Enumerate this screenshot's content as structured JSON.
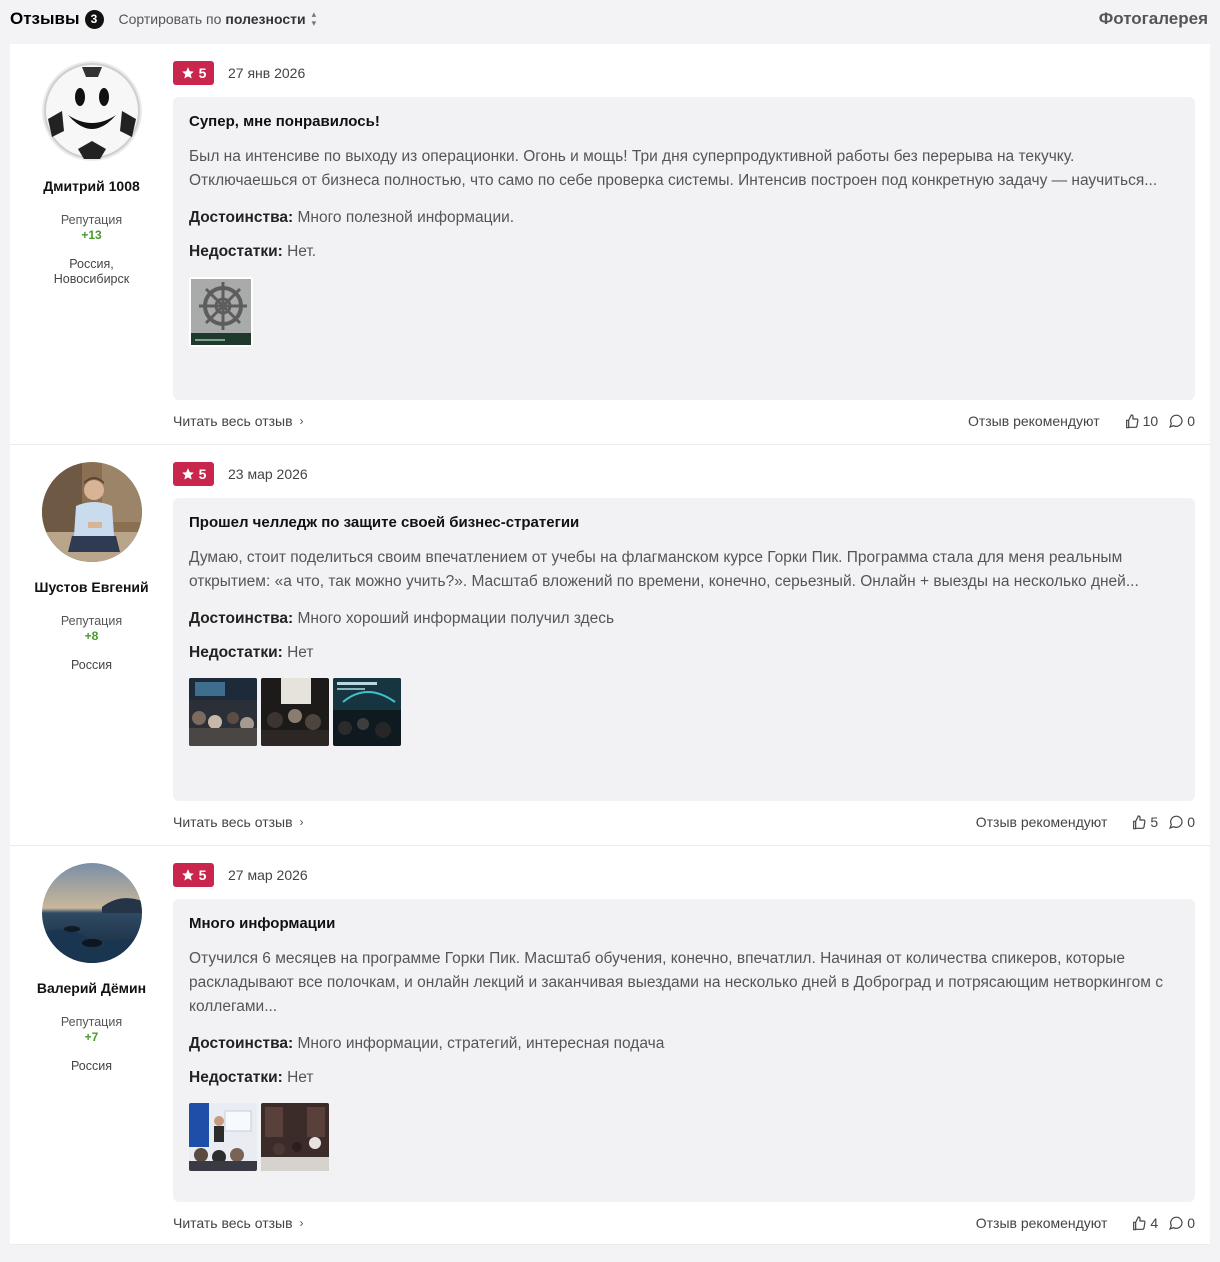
{
  "header": {
    "title": "Отзывы",
    "count": "3",
    "sort_prefix": "Сортировать по",
    "sort_value": "полезности",
    "gallery": "Фотогалерея"
  },
  "labels": {
    "reputation": "Репутация",
    "pros": "Достоинства:",
    "cons": "Недостатки:",
    "read_more": "Читать весь отзыв",
    "recommend": "Отзыв рекомендуют"
  },
  "colors": {
    "rating_badge": "#c8264d",
    "reputation": "#4a9a2a"
  },
  "reviews": [
    {
      "author": "Дмитрий 1008",
      "reputation": "+13",
      "location": "Россия, Новосибирск",
      "rating": "5",
      "date": "27 янв 2026",
      "headline": "Супер, мне понравилось!",
      "text": "Был на интенсиве по выходу из операционки. Огонь и мощь! Три дня суперпродуктивной работы без перерыва на текучку. Отключаешься от бизнеса полностью, что само по себе проверка системы. Интенсив построен под конкретную задачу — научиться...",
      "pros": "Много полезной информации.",
      "cons": "Нет.",
      "likes": "10",
      "comments": "0"
    },
    {
      "author": "Шустов Евгений",
      "reputation": "+8",
      "location": "Россия",
      "rating": "5",
      "date": "23 мар 2026",
      "headline": "Прошел челледж по защите своей бизнес-стратегии",
      "text": "Думаю, стоит поделиться своим впечатлением от учебы на флагманском курсе Горки Пик. Программа стала для меня реальным открытием: «а что, так можно учить?». Масштаб вложений по времени, конечно, серьезный. Онлайн + выезды на несколько дней...",
      "pros": "Много хороший информации получил здесь",
      "cons": "Нет",
      "likes": "5",
      "comments": "0"
    },
    {
      "author": "Валерий Дёмин",
      "reputation": "+7",
      "location": "Россия",
      "rating": "5",
      "date": "27 мар 2026",
      "headline": "Много информации",
      "text": "Отучился 6 месяцев на программе Горки Пик. Масштаб обучения, конечно, впечатлил. Начиная от количества спикеров, которые раскладывают все полочкам, и онлайн лекций и заканчивая выездами на несколько дней в Доброград и потрясающим нетворкингом с коллегами...",
      "pros": "Много информации, стратегий, интересная подача",
      "cons": "Нет",
      "likes": "4",
      "comments": "0"
    }
  ]
}
